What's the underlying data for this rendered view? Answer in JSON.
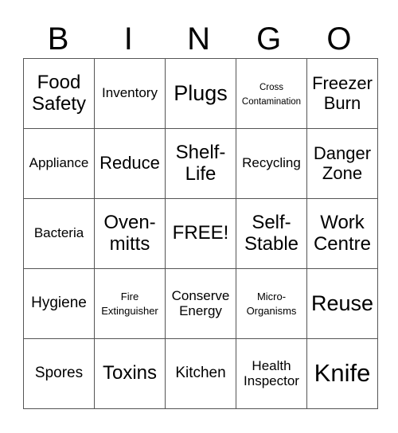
{
  "header": [
    "B",
    "I",
    "N",
    "G",
    "O"
  ],
  "rows": [
    [
      {
        "text": "Food Safety",
        "size": "s-m"
      },
      {
        "text": "Inventory",
        "size": "s-sm"
      },
      {
        "text": "Plugs",
        "size": "s-l"
      },
      {
        "text": "Cross Contamination",
        "size": "s-xxs"
      },
      {
        "text": "Freezer Burn",
        "size": "s-ms"
      }
    ],
    [
      {
        "text": "Appliance",
        "size": "s-sm"
      },
      {
        "text": "Reduce",
        "size": "s-ms"
      },
      {
        "text": "Shelf-Life",
        "size": "s-m"
      },
      {
        "text": "Recycling",
        "size": "s-sm"
      },
      {
        "text": "Danger Zone",
        "size": "s-ms"
      }
    ],
    [
      {
        "text": "Bacteria",
        "size": "s-sm"
      },
      {
        "text": "Oven-mitts",
        "size": "s-m"
      },
      {
        "text": "FREE!",
        "size": "s-m"
      },
      {
        "text": "Self-Stable",
        "size": "s-m"
      },
      {
        "text": "Work Centre",
        "size": "s-m"
      }
    ],
    [
      {
        "text": "Hygiene",
        "size": "s-n"
      },
      {
        "text": "Fire Extinguisher",
        "size": "s-xs"
      },
      {
        "text": "Conserve Energy",
        "size": "s-sm"
      },
      {
        "text": "Micro-Organisms",
        "size": "s-xs"
      },
      {
        "text": "Reuse",
        "size": "s-l"
      }
    ],
    [
      {
        "text": "Spores",
        "size": "s-n"
      },
      {
        "text": "Toxins",
        "size": "s-m"
      },
      {
        "text": "Kitchen",
        "size": "s-n"
      },
      {
        "text": "Health Inspector",
        "size": "s-sm"
      },
      {
        "text": "Knife",
        "size": "s-xl"
      }
    ]
  ]
}
